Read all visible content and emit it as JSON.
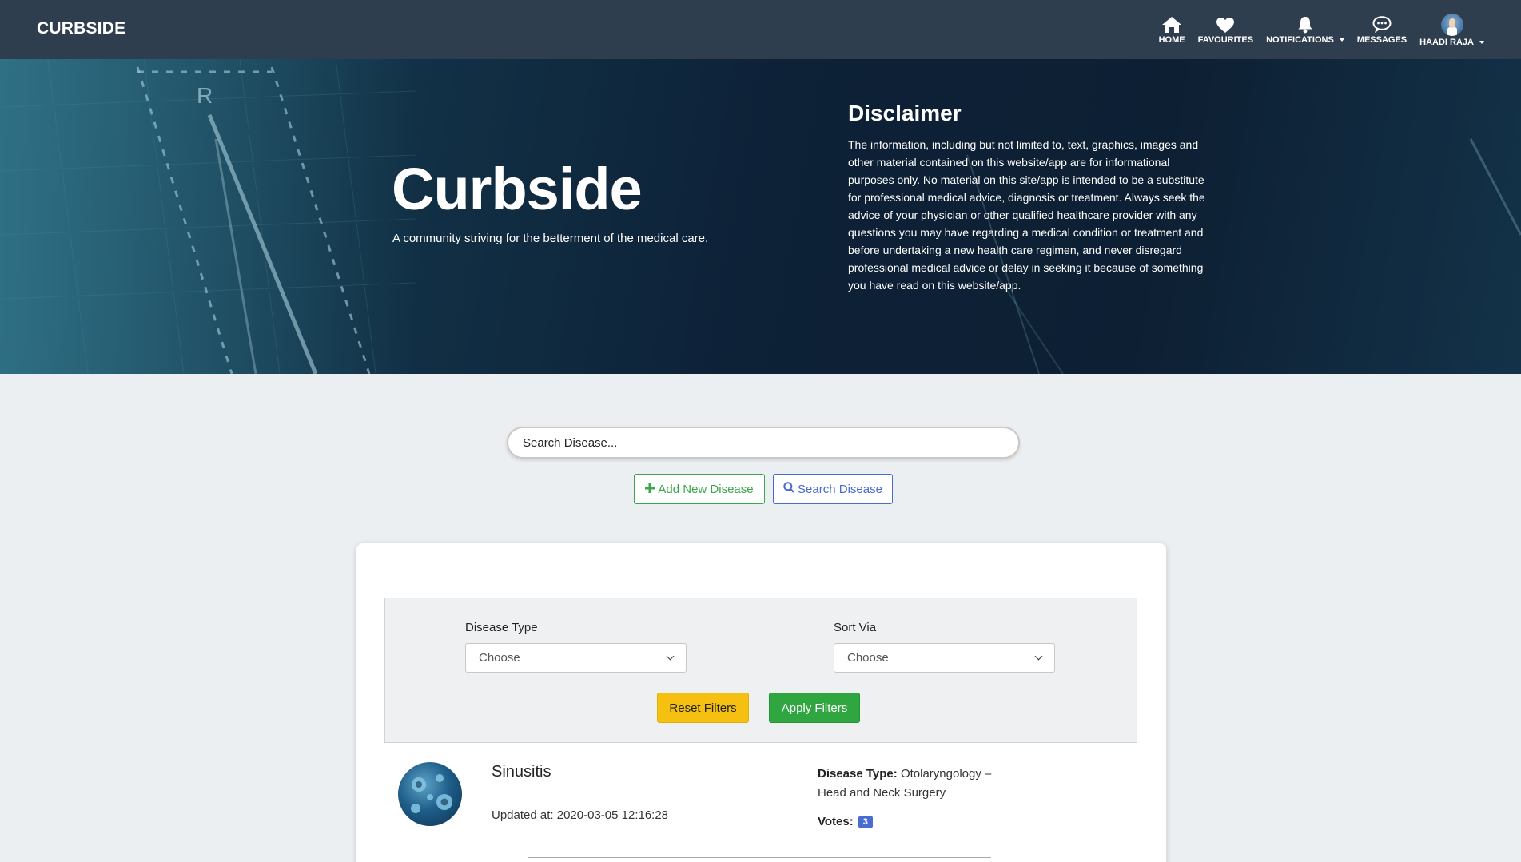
{
  "navbar": {
    "brand": "CURBSIDE",
    "items": [
      {
        "label": "HOME",
        "icon": "home-icon"
      },
      {
        "label": "FAVOURITES",
        "icon": "heart-icon"
      },
      {
        "label": "NOTIFICATIONS",
        "icon": "bell-icon"
      },
      {
        "label": "MESSAGES",
        "icon": "chat-icon"
      },
      {
        "label": "HAADI RAJA",
        "icon": "avatar"
      }
    ]
  },
  "hero": {
    "title": "Curbside",
    "subtitle": "A community striving for the betterment of the medical care.",
    "disclaimer_title": "Disclaimer",
    "disclaimer_text": "The information, including but not limited to, text, graphics, images and other material contained on this website/app are for informational purposes only. No material on this site/app is intended to be a substitute for professional medical advice, diagnosis or treatment. Always seek the advice of your physician or other qualified healthcare provider with any questions you may have regarding a medical condition or treatment and before undertaking a new health care regimen, and never disregard professional medical advice or delay in seeking it because of something you have read on this website/app."
  },
  "search": {
    "placeholder": "Search Disease...",
    "add_label": "Add New Disease",
    "search_label": "Search Disease"
  },
  "filters": {
    "disease_type_label": "Disease Type",
    "disease_type_value": "Choose",
    "sort_label": "Sort Via",
    "sort_value": "Choose",
    "reset_label": "Reset Filters",
    "apply_label": "Apply Filters"
  },
  "diseases": [
    {
      "name": "Sinusitis",
      "updated_label": "Updated at:",
      "updated_value": "2020-03-05 12:16:28",
      "type_label": "Disease Type:",
      "type_value": "Otolaryngology – Head and Neck Surgery",
      "votes_label": "Votes:",
      "votes": "3"
    }
  ],
  "colors": {
    "navbar": "#2f3e4e",
    "add_button": "#3ca64a",
    "search_button": "#4a6bd1",
    "reset_button": "#f5c010",
    "apply_button": "#2fa640",
    "votes_badge": "#4a6bd1"
  }
}
